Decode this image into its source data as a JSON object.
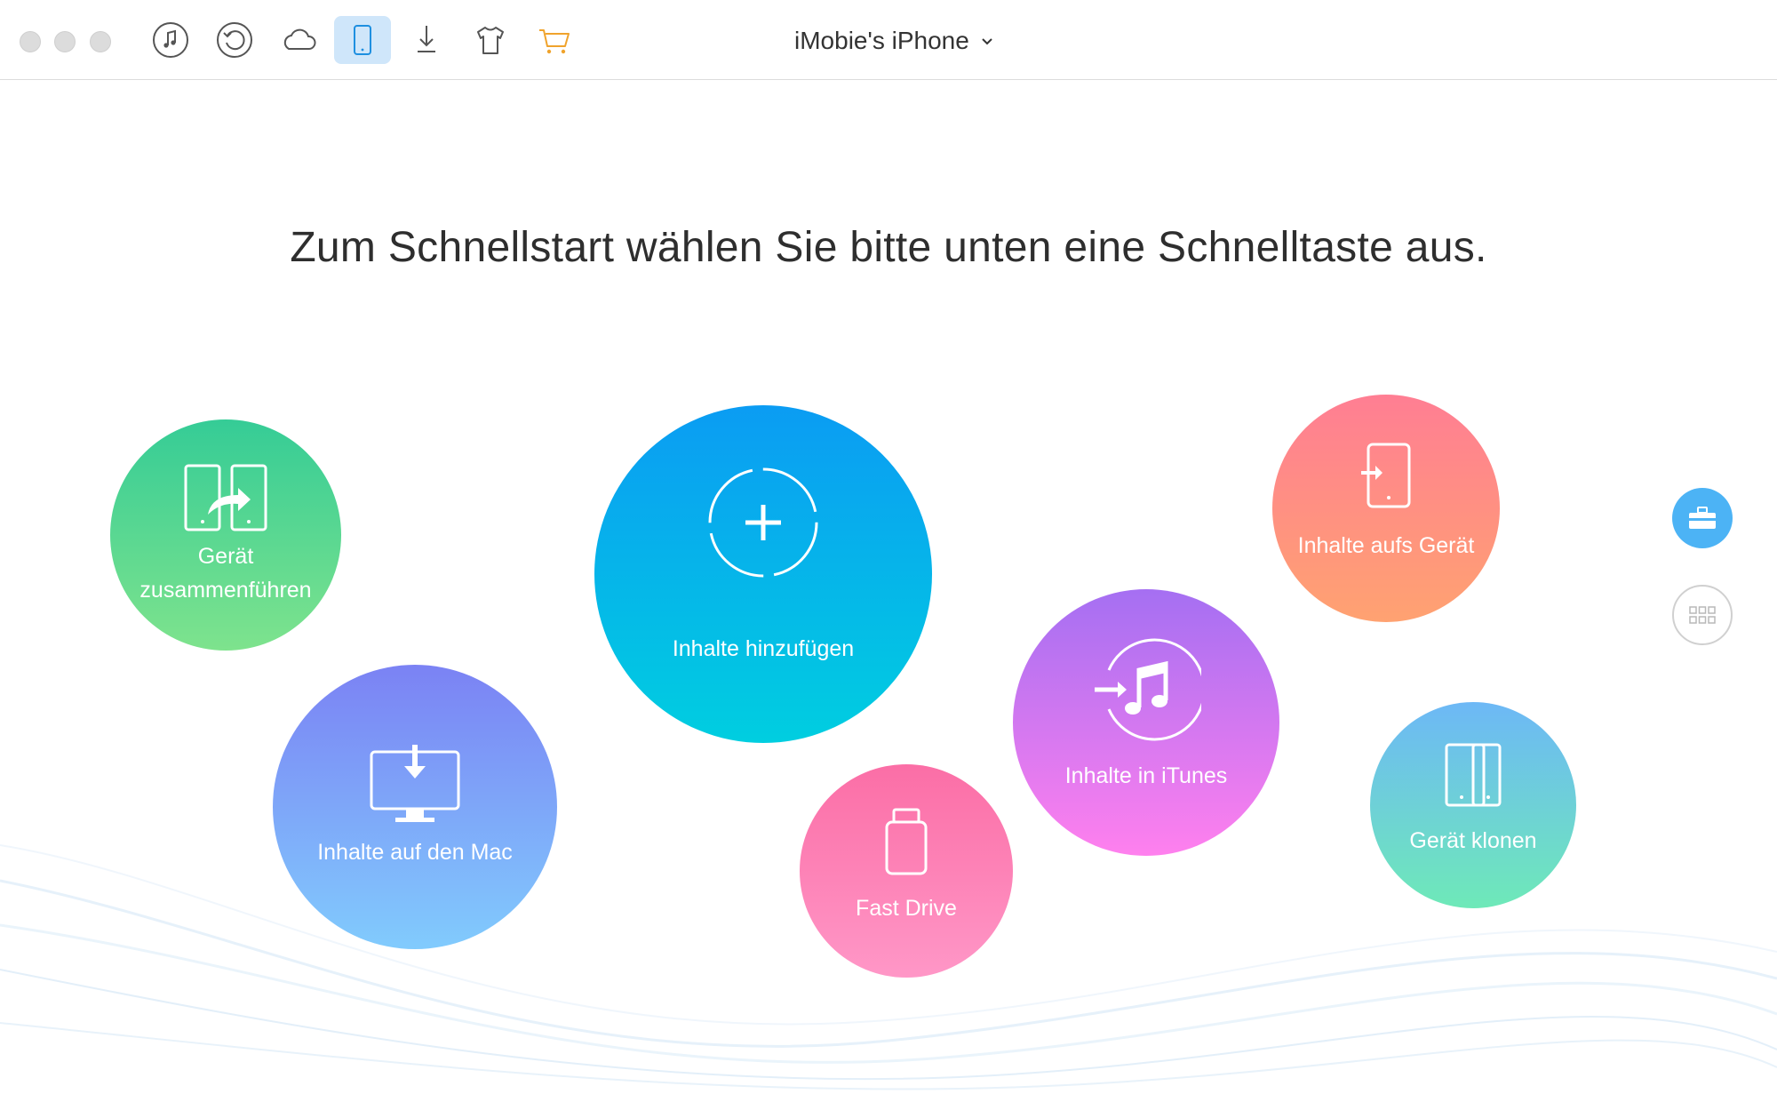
{
  "window": {
    "device_name": "iMobie's iPhone"
  },
  "toolbar": {
    "buttons": [
      {
        "icon": "music-note-icon",
        "active": false
      },
      {
        "icon": "backup-restore-icon",
        "active": false
      },
      {
        "icon": "icloud-icon",
        "active": false
      },
      {
        "icon": "iphone-device-icon",
        "active": true
      },
      {
        "icon": "download-icon",
        "active": false
      },
      {
        "icon": "tshirt-theme-icon",
        "active": false
      },
      {
        "icon": "shopping-cart-icon",
        "active": false
      }
    ]
  },
  "main": {
    "headline": "Zum Schnellstart wählen Sie bitte unten eine Schnelltaste aus.",
    "shortcuts": {
      "merge": {
        "line1": "Gerät",
        "line2": "zusammenführen",
        "icon": "device-merge-icon"
      },
      "add": {
        "label": "Inhalte hinzufügen",
        "icon": "add-plus-icon"
      },
      "to_device": {
        "label": "Inhalte aufs Gerät",
        "icon": "to-device-icon"
      },
      "to_mac": {
        "label": "Inhalte auf den Mac",
        "icon": "to-mac-icon"
      },
      "to_itunes": {
        "label": "Inhalte in iTunes",
        "icon": "itunes-icon"
      },
      "fast_drive": {
        "label": "Fast Drive",
        "icon": "usb-drive-icon"
      },
      "clone": {
        "label": "Gerät klonen",
        "icon": "device-clone-icon"
      }
    }
  },
  "side": {
    "buttons": [
      {
        "icon": "toolbox-icon",
        "active": true
      },
      {
        "icon": "grid-icon",
        "active": false
      }
    ]
  },
  "colors": {
    "accent": "#4cb3f5",
    "cart": "#f0a32c"
  }
}
